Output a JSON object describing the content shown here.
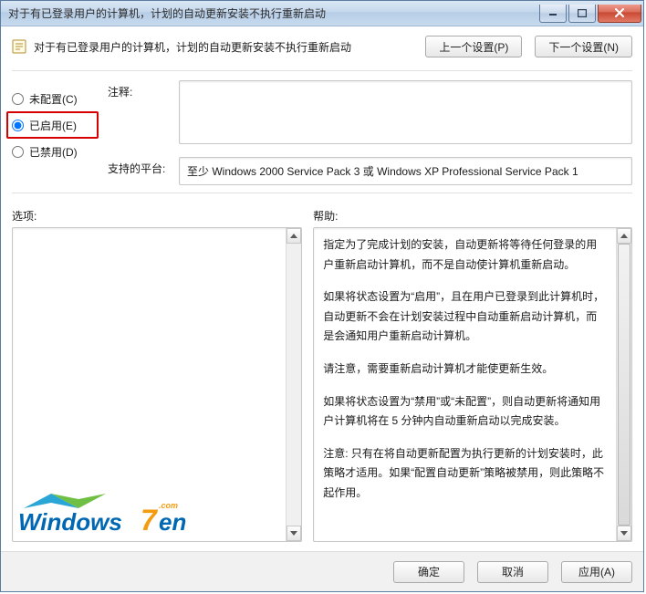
{
  "window": {
    "title": "对于有已登录用户的计算机，计划的自动更新安装不执行重新启动"
  },
  "header": {
    "title": "对于有已登录用户的计算机，计划的自动更新安装不执行重新启动",
    "prev": "上一个设置(P)",
    "next": "下一个设置(N)"
  },
  "radios": {
    "not_configured": "未配置(C)",
    "enabled": "已启用(E)",
    "disabled": "已禁用(D)"
  },
  "fields": {
    "comment_label": "注释:",
    "comment_value": "",
    "platform_label": "支持的平台:",
    "platform_value": "至少 Windows 2000 Service Pack 3 或 Windows XP Professional Service Pack 1"
  },
  "sections": {
    "options_label": "选项:",
    "help_label": "帮助:"
  },
  "help": {
    "p1": "指定为了完成计划的安装，自动更新将等待任何登录的用户重新启动计算机，而不是自动使计算机重新启动。",
    "p2": "如果将状态设置为“启用”，且在用户已登录到此计算机时，自动更新不会在计划安装过程中自动重新启动计算机，而是会通知用户重新启动计算机。",
    "p3": "请注意，需要重新启动计算机才能使更新生效。",
    "p4": "如果将状态设置为“禁用”或“未配置”，则自动更新将通知用户计算机将在 5 分钟内自动重新启动以完成安装。",
    "p5": "注意: 只有在将自动更新配置为执行更新的计划安装时，此策略才适用。如果“配置自动更新”策略被禁用，则此策略不起作用。"
  },
  "footer": {
    "ok": "确定",
    "cancel": "取消",
    "apply": "应用(A)"
  },
  "logo": {
    "text": "Windows7en",
    "suffix": ".com"
  }
}
